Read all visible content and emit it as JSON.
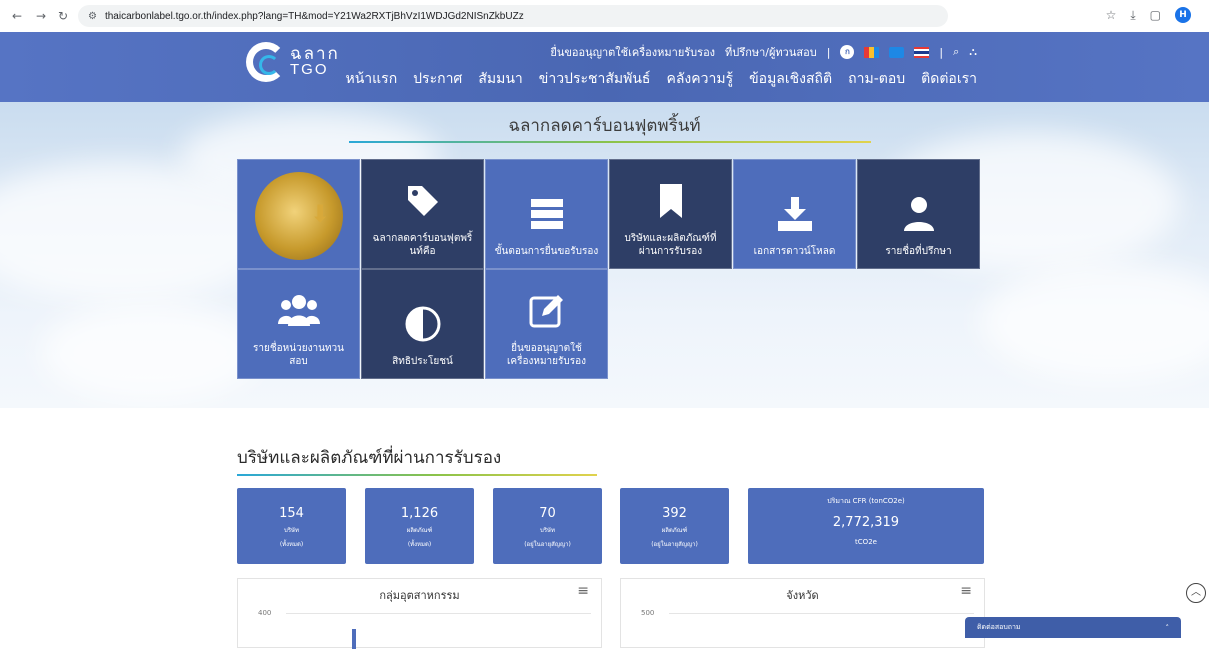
{
  "browser": {
    "url": "thaicarbonlabel.tgo.or.th/index.php?lang=TH&mod=Y21Wa2RXTjBhVzI1WDJGd2NISnZkbUZz",
    "profile_initial": "H"
  },
  "header": {
    "logo_line1": "ฉลาก",
    "logo_line2": "TGO",
    "top_links": [
      "ยื่นขออนุญาตใช้เครื่องหมายรับรอง",
      "ที่ปรึกษา/ผู้ทวนสอบ"
    ],
    "main_nav": [
      "หน้าแรก",
      "ประกาศ",
      "สัมมนา",
      "ข่าวประชาสัมพันธ์",
      "คลังความรู้",
      "ข้อมูลเชิงสถิติ",
      "ถาม-ตอบ",
      "ติดต่อเรา"
    ],
    "colors": {
      "header_bg": "#4e6dbb",
      "tile_navy": "#2e3e66"
    }
  },
  "hero": {
    "title": "ฉลากลดคาร์บอนฟุตพริ้นท์",
    "tiles": [
      {
        "label": "",
        "icon": "carbon-label-logo-icon"
      },
      {
        "label": "ฉลากลดคาร์บอนฟุตพริ้นท์คือ",
        "icon": "tag-icon"
      },
      {
        "label": "ขั้นตอนการยื่นขอรับรอง",
        "icon": "server-list-icon"
      },
      {
        "label": "บริษัทและผลิตภัณฑ์ที่ผ่านการรับรอง",
        "icon": "bookmark-icon"
      },
      {
        "label": "เอกสารดาวน์โหลด",
        "icon": "download-icon"
      },
      {
        "label": "รายชื่อที่ปรึกษา",
        "icon": "doctor-icon"
      },
      {
        "label": "รายชื่อหน่วยงานทวนสอบ",
        "icon": "users-icon"
      },
      {
        "label": "สิทธิประโยชน์",
        "icon": "contrast-icon"
      },
      {
        "label": "ยื่นขออนุญาตใช้เครื่องหมายรับรอง",
        "icon": "edit-icon"
      }
    ]
  },
  "certified": {
    "title": "บริษัทและผลิตภัณฑ์ที่ผ่านการรับรอง",
    "stats": [
      {
        "value": "154",
        "caption1": "บริษัท",
        "caption2": "(ทั้งหมด)"
      },
      {
        "value": "1,126",
        "caption1": "ผลิตภัณฑ์",
        "caption2": "(ทั้งหมด)"
      },
      {
        "value": "70",
        "caption1": "บริษัท",
        "caption2": "(อยู่ในอายุสัญญา)"
      },
      {
        "value": "392",
        "caption1": "ผลิตภัณฑ์",
        "caption2": "(อยู่ในอายุสัญญา)"
      }
    ],
    "cfr": {
      "caption": "ปริมาณ CFR (tonCO2e)",
      "value": "2,772,319",
      "unit": "tCO2e"
    },
    "charts": [
      {
        "title": "กลุ่มอุตสาหกรรม",
        "top_tick": "400"
      },
      {
        "title": "จังหวัด",
        "top_tick": "500"
      }
    ]
  },
  "contact": {
    "label": "ติดต่อสอบถาม"
  }
}
